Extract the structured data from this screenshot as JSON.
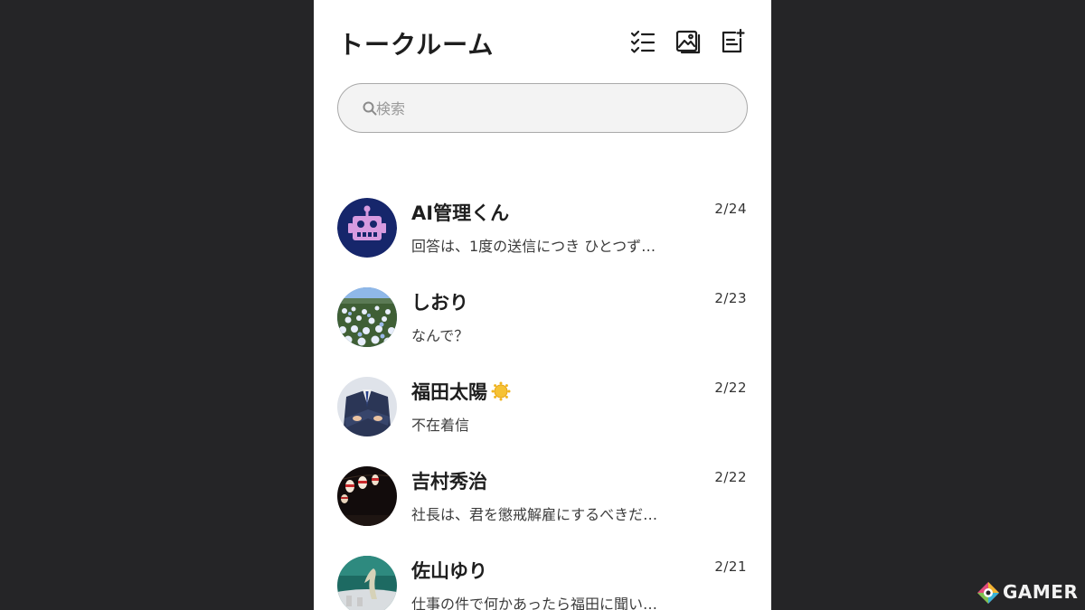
{
  "header": {
    "title": "トークルーム",
    "icons": [
      "checklist-icon",
      "image-icon",
      "new-note-icon"
    ]
  },
  "search": {
    "placeholder": "検索",
    "value": ""
  },
  "chats": [
    {
      "name": "AI管理くん",
      "date": "2/24",
      "preview": "回答は、1度の送信につき ひとつず…",
      "avatar": "robot-avatar"
    },
    {
      "name": "しおり",
      "date": "2/23",
      "preview": "なんで？",
      "avatar": "flower-field-avatar"
    },
    {
      "name": "福田太陽",
      "date": "2/22",
      "preview": "不在着信",
      "avatar": "businessman-avatar",
      "badge": "sun-icon"
    },
    {
      "name": "吉村秀治",
      "date": "2/22",
      "preview": "社長は、君を懲戒解雇にするべきだ…",
      "avatar": "lanterns-night-avatar"
    },
    {
      "name": "佐山ゆり",
      "date": "2/21",
      "preview": "仕事の件で何かあったら福田に聞い…",
      "avatar": "sea-avatar"
    }
  ],
  "watermark": {
    "text": "GAMER"
  },
  "colors": {
    "background": "#252527",
    "panel": "#ffffff",
    "robot_bg": "#16266b",
    "robot_face": "#d79be0"
  }
}
